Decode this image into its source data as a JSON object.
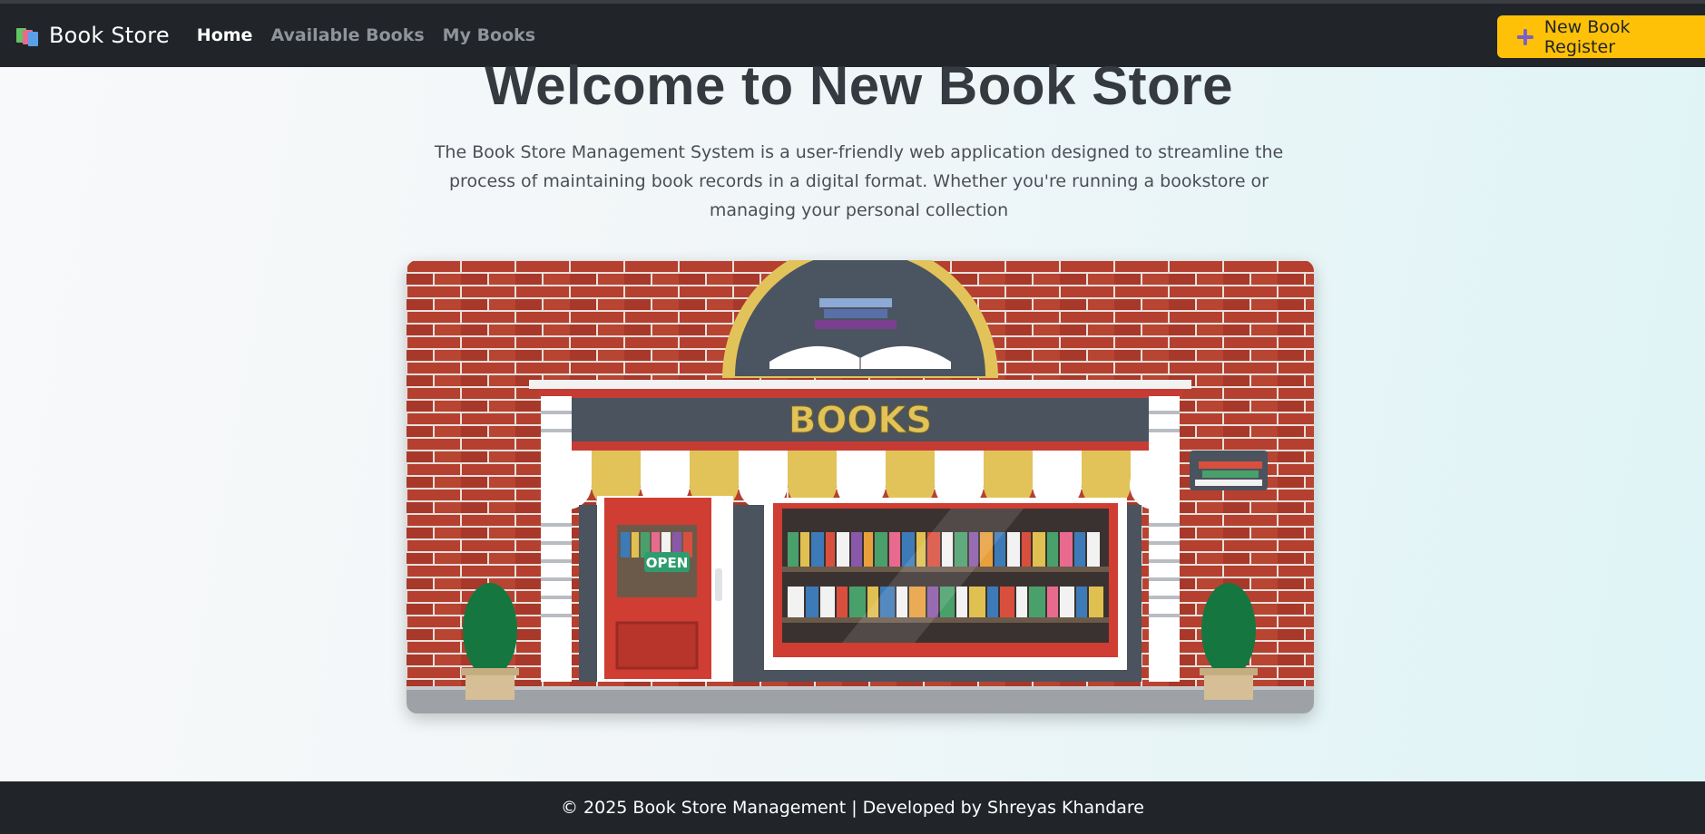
{
  "navbar": {
    "brand": "Book Store",
    "logo_icon": "books-stack-icon",
    "links": [
      {
        "label": "Home",
        "active": true
      },
      {
        "label": "Available Books",
        "active": false
      },
      {
        "label": "My Books",
        "active": false
      }
    ],
    "register_button": {
      "label": "New Book Register",
      "icon": "plus-icon"
    }
  },
  "hero": {
    "title": "Welcome to New Book Store",
    "description": "The Book Store Management System is a user-friendly web application designed to streamline the process of maintaining book records in a digital format. Whether you're running a bookstore or managing your personal collection",
    "image": {
      "sign_text": "BOOKS",
      "door_sign": "OPEN"
    }
  },
  "footer": {
    "text": "© 2025 Book Store Management | Developed by Shreyas Khandare"
  },
  "colors": {
    "navbar_bg": "#212529",
    "accent_yellow": "#ffc107",
    "title_color": "#343a40",
    "brick_red": "#b0392b"
  }
}
